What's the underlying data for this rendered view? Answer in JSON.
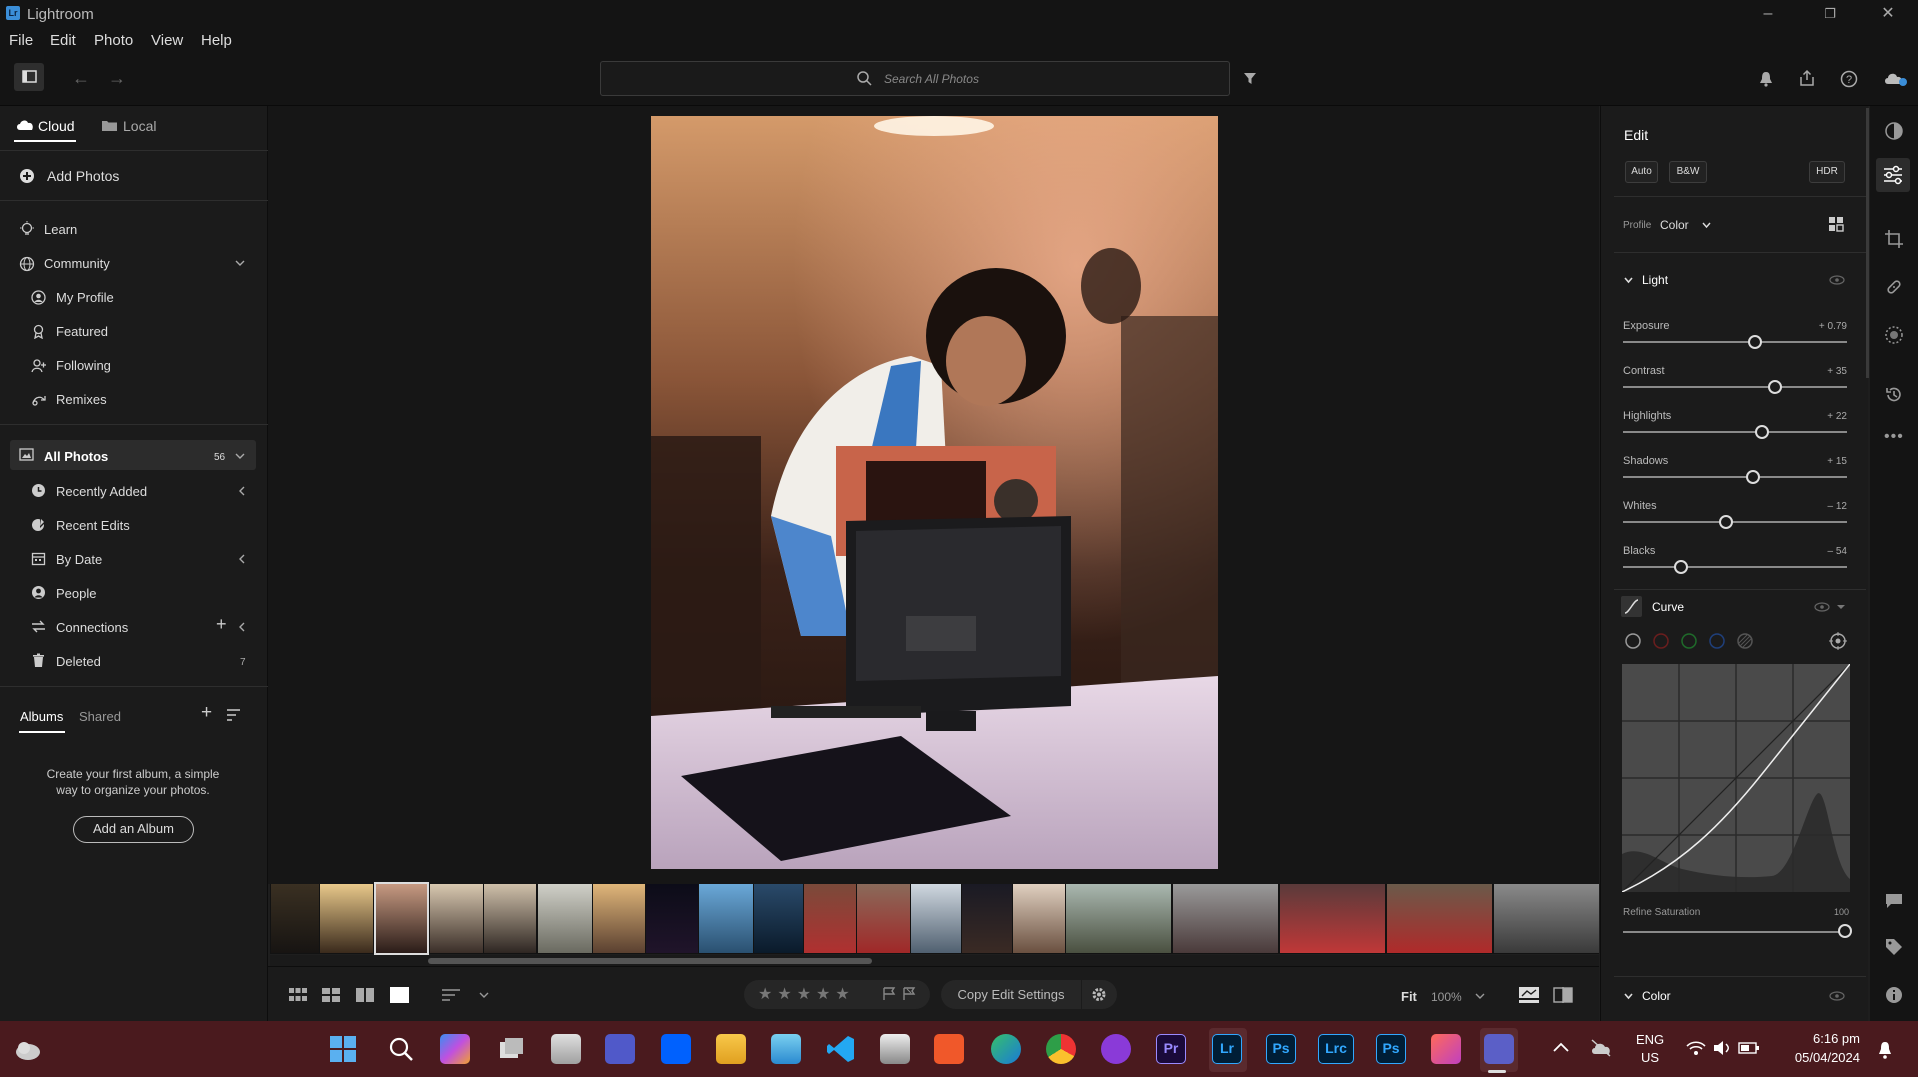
{
  "app": {
    "title": "Lightroom",
    "logo_text": "Lr"
  },
  "menu": {
    "file": "File",
    "edit": "Edit",
    "photo": "Photo",
    "view": "View",
    "help": "Help"
  },
  "search": {
    "placeholder": "Search All Photos"
  },
  "left": {
    "tabs": {
      "cloud": "Cloud",
      "local": "Local"
    },
    "add_photos": "Add Photos",
    "learn": "Learn",
    "community": "Community",
    "community_items": [
      "My Profile",
      "Featured",
      "Following",
      "Remixes"
    ],
    "all_photos": {
      "label": "All Photos",
      "count": "56"
    },
    "library_items": [
      {
        "label": "Recently Added",
        "count": ""
      },
      {
        "label": "Recent Edits",
        "count": ""
      },
      {
        "label": "By Date",
        "count": ""
      },
      {
        "label": "People",
        "count": ""
      },
      {
        "label": "Connections",
        "count": ""
      },
      {
        "label": "Deleted",
        "count": "7"
      }
    ],
    "albums_tab": "Albums",
    "shared_tab": "Shared",
    "empty_text": "Create your first album, a simple way to organize your photos.",
    "add_album": "Add an Album"
  },
  "bottom": {
    "copy_edit": "Copy Edit Settings",
    "fit": "Fit",
    "zoom": "100%"
  },
  "edit": {
    "title": "Edit",
    "auto": "Auto",
    "bw": "B&W",
    "hdr": "HDR",
    "profile_label": "Profile",
    "profile_value": "Color",
    "light_header": "Light",
    "sliders": [
      {
        "label": "Exposure",
        "value": "+ 0.79",
        "pos": 0.59
      },
      {
        "label": "Contrast",
        "value": "+ 35",
        "pos": 0.68
      },
      {
        "label": "Highlights",
        "value": "+ 22",
        "pos": 0.62
      },
      {
        "label": "Shadows",
        "value": "+ 15",
        "pos": 0.58
      },
      {
        "label": "Whites",
        "value": "– 12",
        "pos": 0.46
      },
      {
        "label": "Blacks",
        "value": "– 54",
        "pos": 0.26
      }
    ],
    "curve_header": "Curve",
    "refine_label": "Refine Saturation",
    "refine_value": "100",
    "color_header": "Color"
  },
  "taskbar": {
    "lang": "ENG",
    "region": "US",
    "time": "6:16 pm",
    "date": "05/04/2024",
    "apps": [
      "windows-start",
      "search",
      "copilot",
      "task-view",
      "store",
      "teams",
      "dropbox",
      "file-explorer",
      "photos",
      "vscode",
      "printer",
      "app-orange",
      "edge",
      "chrome",
      "app-purple",
      "premiere-pro",
      "lightroom",
      "photoshop",
      "lightroom-classic",
      "photoshop",
      "creative-cloud",
      "teams"
    ]
  },
  "colors": {
    "accent": "#3b8ed8",
    "taskbar": "#4a1a1e"
  }
}
